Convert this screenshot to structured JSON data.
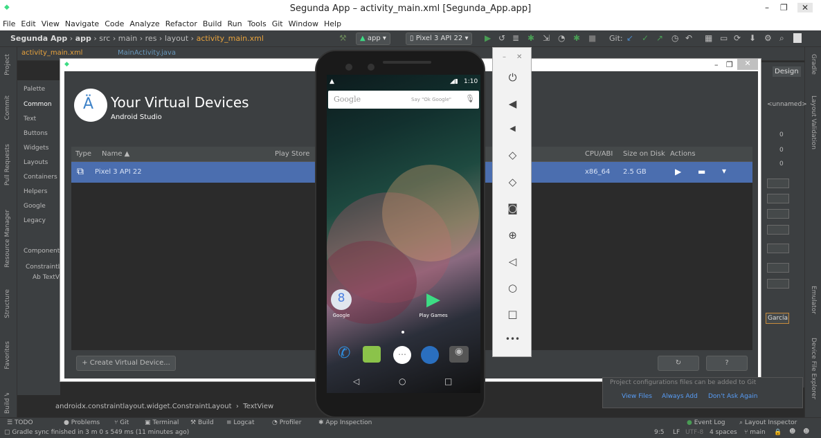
{
  "window": {
    "title": "Segunda App – activity_main.xml [Segunda_App.app]",
    "min": "–",
    "max": "❐",
    "close": "✕"
  },
  "menu": [
    "File",
    "Edit",
    "View",
    "Navigate",
    "Code",
    "Analyze",
    "Refactor",
    "Build",
    "Run",
    "Tools",
    "Git",
    "Window",
    "Help"
  ],
  "breadcrumb": {
    "project": "Segunda App",
    "module": "app",
    "p1": "src",
    "p2": "main",
    "p3": "res",
    "p4": "layout",
    "file": "activity_main.xml"
  },
  "toolbar": {
    "run_config": "app",
    "device": "Pixel 3 API 22",
    "git_label": "Git:"
  },
  "editor_tabs": [
    "activity_main.xml",
    "MainActivity.java"
  ],
  "left_strip": [
    "Project",
    "Commit",
    "Pull Requests",
    "Resource Manager",
    "Structure",
    "Favorites",
    "Build Variants"
  ],
  "right_strip": [
    "Gradle",
    "Layout Validation",
    "Emulator",
    "Device File Explorer"
  ],
  "palette": {
    "title": "Palette",
    "items": [
      "Common",
      "Text",
      "Buttons",
      "Widgets",
      "Layouts",
      "Containers",
      "Helpers",
      "Google",
      "Legacy"
    ],
    "tree_title": "Component Tree",
    "tree_items": [
      "ConstraintLayout",
      "Ab TextView"
    ]
  },
  "design": {
    "tab": "Design",
    "unnamed": "<unnamed>",
    "values": [
      "0",
      "0",
      "0"
    ],
    "field_text": "García"
  },
  "avd": {
    "title": "Your Virtual Devices",
    "subtitle": "Android Studio",
    "headers": {
      "type": "Type",
      "name": "Name ▲",
      "play_store": "Play Store",
      "cpu": "CPU/ABI",
      "size": "Size on Disk",
      "actions": "Actions"
    },
    "row": {
      "name": "Pixel 3 API 22",
      "cpu": "x86_64",
      "size": "2.5 GB"
    },
    "create_button": "+ Create Virtual Device...",
    "refresh": "↻",
    "help": "?"
  },
  "emulator": {
    "time": "1:10",
    "search_brand": "Google",
    "search_hint": "Say \"Ok Google\"",
    "apps": [
      {
        "name": "Google"
      },
      {
        "name": "Play Games"
      }
    ]
  },
  "emu_toolbar": {
    "min": "–",
    "close": "✕"
  },
  "layout_breadcrumb": {
    "a": "androidx.constraintlayout.widget.ConstraintLayout",
    "b": "TextView"
  },
  "notification": {
    "text": "Project configurations files can be added to Git",
    "actions": [
      "View Files",
      "Always Add",
      "Don't Ask Again"
    ]
  },
  "bottom_tools": [
    "TODO",
    "Problems",
    "Git",
    "Terminal",
    "Build",
    "Logcat",
    "Profiler",
    "App Inspection"
  ],
  "bottom_right": [
    "Event Log",
    "Layout Inspector"
  ],
  "status": {
    "message": "Gradle sync finished in 3 m 0 s 549 ms (11 minutes ago)",
    "pos": "9:5",
    "lf": "LF",
    "enc": "UTF-8",
    "indent": "4 spaces",
    "branch": "main"
  },
  "colors": {
    "selection": "#4b6eaf",
    "bg": "#2b2b2b",
    "panel": "#3c3f41"
  }
}
